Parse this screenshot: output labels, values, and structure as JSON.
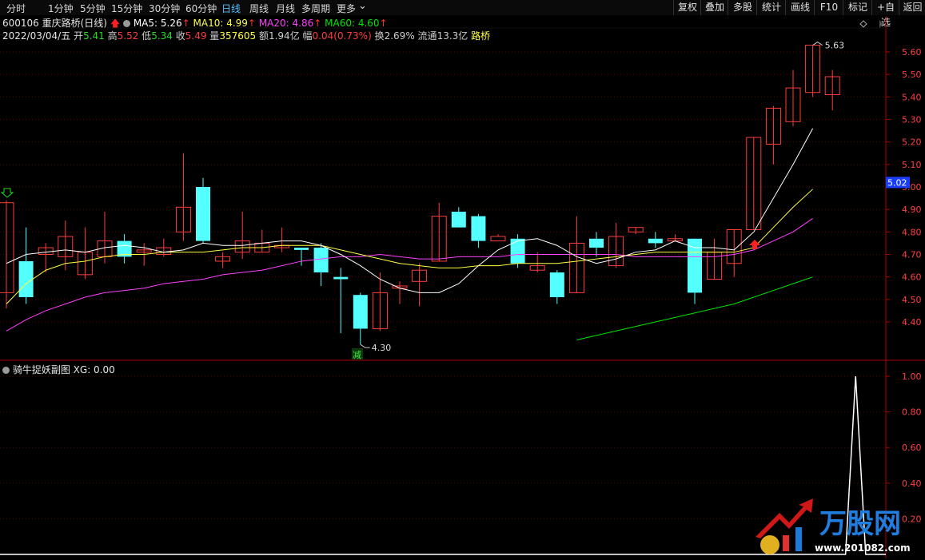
{
  "toolbar": {
    "periods": [
      "分时",
      "1分钟",
      "5分钟",
      "15分钟",
      "30分钟",
      "60分钟",
      "日线",
      "周线",
      "月线",
      "多周期",
      "更多"
    ],
    "active_index": 6,
    "buttons": [
      "复权",
      "叠加",
      "多股",
      "统计",
      "画线",
      "F10",
      "标记",
      "+自选",
      "返回"
    ]
  },
  "stock": {
    "code_name": "600106 重庆路桥(日线)",
    "ma5": "MA5: 5.26",
    "ma10": "MA10: 4.99",
    "ma20": "MA20: 4.86",
    "ma60": "MA60: 4.60",
    "date": "2022/03/04/五",
    "open_label": "开",
    "open": "5.41",
    "high_label": "高",
    "high": "5.52",
    "low_label": "低",
    "low": "5.34",
    "close_label": "收",
    "close": "5.49",
    "vol_label": "量",
    "vol": "357605",
    "amt_label": "额",
    "amt": "1.94亿",
    "chg_label": "幅",
    "chg": "0.04(0.73%)",
    "turn_label": "换",
    "turn": "2.69%",
    "float_label": "流通",
    "float": "13.3亿",
    "concept": "路桥"
  },
  "colors": {
    "up": "#ff3c3c",
    "down": "#54ffff",
    "ma5": "#ffffff",
    "ma10": "#ffff40",
    "ma20": "#ff40ff",
    "ma60": "#00e600",
    "axis": "#b00000",
    "grid": "#5a0000"
  },
  "main_axis": {
    "labels": [
      "5.60",
      "5.50",
      "5.40",
      "5.30",
      "5.20",
      "5.10",
      "5.00",
      "4.90",
      "4.80",
      "4.70",
      "4.60",
      "4.50",
      "4.40"
    ],
    "current": "5.02"
  },
  "annotations": {
    "high": "5.63",
    "low": "4.30",
    "reduce": "减"
  },
  "sub_panel": {
    "title": "骑牛捉妖副图",
    "xg": "XG: 0.00",
    "labels": [
      "1.00",
      "0.80",
      "0.60",
      "0.40",
      "0.20"
    ]
  },
  "logo": {
    "text": "万股网",
    "url": "www.201082.com"
  },
  "icons": {
    "up_arrow": "up-arrow-icon",
    "circle": "circle-icon",
    "diamond": "diamond-icon",
    "down_marker": "down-arrow-icon"
  },
  "chart_data": {
    "type": "candlestick",
    "ylim": [
      4.3,
      5.65
    ],
    "candles": [
      {
        "o": 4.53,
        "h": 4.94,
        "l": 4.46,
        "c": 4.93
      },
      {
        "o": 4.67,
        "h": 4.82,
        "l": 4.48,
        "c": 4.51
      },
      {
        "o": 4.7,
        "h": 4.75,
        "l": 4.62,
        "c": 4.73
      },
      {
        "o": 4.69,
        "h": 4.85,
        "l": 4.63,
        "c": 4.78
      },
      {
        "o": 4.61,
        "h": 4.82,
        "l": 4.59,
        "c": 4.71
      },
      {
        "o": 4.69,
        "h": 4.89,
        "l": 4.66,
        "c": 4.76
      },
      {
        "o": 4.76,
        "h": 4.79,
        "l": 4.66,
        "c": 4.69
      },
      {
        "o": 4.71,
        "h": 4.75,
        "l": 4.65,
        "c": 4.72
      },
      {
        "o": 4.7,
        "h": 4.77,
        "l": 4.69,
        "c": 4.73
      },
      {
        "o": 4.8,
        "h": 5.15,
        "l": 4.76,
        "c": 4.91
      },
      {
        "o": 5.0,
        "h": 5.04,
        "l": 4.75,
        "c": 4.76
      },
      {
        "o": 4.67,
        "h": 4.71,
        "l": 4.64,
        "c": 4.69
      },
      {
        "o": 4.71,
        "h": 4.89,
        "l": 4.68,
        "c": 4.76
      },
      {
        "o": 4.71,
        "h": 4.81,
        "l": 4.71,
        "c": 4.75
      },
      {
        "o": 4.73,
        "h": 4.82,
        "l": 4.71,
        "c": 4.74
      },
      {
        "o": 4.73,
        "h": 4.73,
        "l": 4.65,
        "c": 4.72
      },
      {
        "o": 4.73,
        "h": 4.75,
        "l": 4.56,
        "c": 4.62
      },
      {
        "o": 4.6,
        "h": 4.64,
        "l": 4.35,
        "c": 4.59
      },
      {
        "o": 4.52,
        "h": 4.53,
        "l": 4.3,
        "c": 4.37
      },
      {
        "o": 4.37,
        "h": 4.62,
        "l": 4.36,
        "c": 4.53
      },
      {
        "o": 4.55,
        "h": 4.58,
        "l": 4.48,
        "c": 4.56
      },
      {
        "o": 4.58,
        "h": 4.66,
        "l": 4.47,
        "c": 4.63
      },
      {
        "o": 4.67,
        "h": 4.93,
        "l": 4.67,
        "c": 4.87
      },
      {
        "o": 4.89,
        "h": 4.91,
        "l": 4.83,
        "c": 4.82
      },
      {
        "o": 4.87,
        "h": 4.88,
        "l": 4.73,
        "c": 4.76
      },
      {
        "o": 4.76,
        "h": 4.79,
        "l": 4.78,
        "c": 4.78
      },
      {
        "o": 4.77,
        "h": 4.79,
        "l": 4.64,
        "c": 4.66
      },
      {
        "o": 4.63,
        "h": 4.71,
        "l": 4.62,
        "c": 4.65
      },
      {
        "o": 4.62,
        "h": 4.63,
        "l": 4.48,
        "c": 4.51
      },
      {
        "o": 4.53,
        "h": 4.87,
        "l": 4.53,
        "c": 4.75
      },
      {
        "o": 4.77,
        "h": 4.8,
        "l": 4.69,
        "c": 4.73
      },
      {
        "o": 4.65,
        "h": 4.84,
        "l": 4.64,
        "c": 4.78
      },
      {
        "o": 4.8,
        "h": 4.82,
        "l": 4.79,
        "c": 4.82
      },
      {
        "o": 4.77,
        "h": 4.8,
        "l": 4.73,
        "c": 4.75
      },
      {
        "o": 4.76,
        "h": 4.79,
        "l": 4.76,
        "c": 4.77
      },
      {
        "o": 4.77,
        "h": 4.77,
        "l": 4.48,
        "c": 4.53
      },
      {
        "o": 4.59,
        "h": 4.77,
        "l": 4.59,
        "c": 4.71
      },
      {
        "o": 4.66,
        "h": 4.81,
        "l": 4.6,
        "c": 4.81
      },
      {
        "o": 4.81,
        "h": 5.22,
        "l": 4.81,
        "c": 5.22
      },
      {
        "o": 5.19,
        "h": 5.36,
        "l": 5.1,
        "c": 5.35
      },
      {
        "o": 5.29,
        "h": 5.52,
        "l": 5.27,
        "c": 5.44
      },
      {
        "o": 5.42,
        "h": 5.63,
        "l": 5.4,
        "c": 5.63
      },
      {
        "o": 5.41,
        "h": 5.52,
        "l": 5.34,
        "c": 5.49
      }
    ],
    "ma5": [
      4.66,
      4.7,
      4.71,
      4.72,
      4.71,
      4.73,
      4.74,
      4.73,
      4.71,
      4.72,
      4.75,
      4.74,
      4.74,
      4.75,
      4.76,
      4.76,
      4.74,
      4.7,
      4.65,
      4.59,
      4.55,
      4.53,
      4.53,
      4.57,
      4.65,
      4.72,
      4.76,
      4.77,
      4.74,
      4.69,
      4.66,
      4.68,
      4.71,
      4.72,
      4.76,
      4.73,
      4.73,
      4.72,
      4.8,
      4.95,
      5.1,
      5.26
    ],
    "ma10": [
      4.48,
      4.57,
      4.63,
      4.66,
      4.67,
      4.69,
      4.7,
      4.7,
      4.71,
      4.71,
      4.71,
      4.72,
      4.73,
      4.73,
      4.74,
      4.74,
      4.74,
      4.72,
      4.7,
      4.68,
      4.66,
      4.65,
      4.64,
      4.64,
      4.65,
      4.65,
      4.66,
      4.66,
      4.66,
      4.67,
      4.68,
      4.69,
      4.7,
      4.71,
      4.71,
      4.71,
      4.71,
      4.71,
      4.73,
      4.82,
      4.91,
      4.99
    ],
    "ma20": [
      4.36,
      4.41,
      4.45,
      4.48,
      4.51,
      4.53,
      4.54,
      4.55,
      4.57,
      4.58,
      4.59,
      4.61,
      4.62,
      4.63,
      4.65,
      4.67,
      4.68,
      4.69,
      4.69,
      4.7,
      4.69,
      4.68,
      4.68,
      4.69,
      4.69,
      4.69,
      4.7,
      4.7,
      4.7,
      4.7,
      4.7,
      4.7,
      4.69,
      4.69,
      4.69,
      4.69,
      4.69,
      4.7,
      4.72,
      4.76,
      4.8,
      4.86
    ],
    "ma60_start": 29,
    "ma60": [
      4.32,
      4.34,
      4.36,
      4.38,
      4.4,
      4.42,
      4.44,
      4.46,
      4.48,
      4.51,
      4.54,
      4.57,
      4.6
    ],
    "xg": [
      0,
      0,
      0,
      0,
      0,
      0,
      0,
      0,
      0,
      0,
      0,
      0,
      0,
      0,
      0,
      0,
      0,
      0,
      0,
      0,
      0,
      0,
      0,
      0,
      0,
      0,
      0,
      0,
      0,
      0,
      0,
      0,
      0,
      0,
      0,
      0,
      0,
      0,
      0,
      0,
      0,
      0,
      0,
      0,
      0,
      0,
      0,
      0,
      0,
      0,
      0,
      0,
      0,
      0,
      0,
      0,
      0,
      0,
      0,
      0,
      0,
      0,
      0,
      0,
      0,
      0,
      0,
      0,
      0,
      0,
      0,
      0,
      0,
      0,
      0,
      0,
      0,
      0,
      0,
      0,
      0,
      0,
      0,
      0,
      0,
      1,
      0,
      0,
      0
    ]
  }
}
